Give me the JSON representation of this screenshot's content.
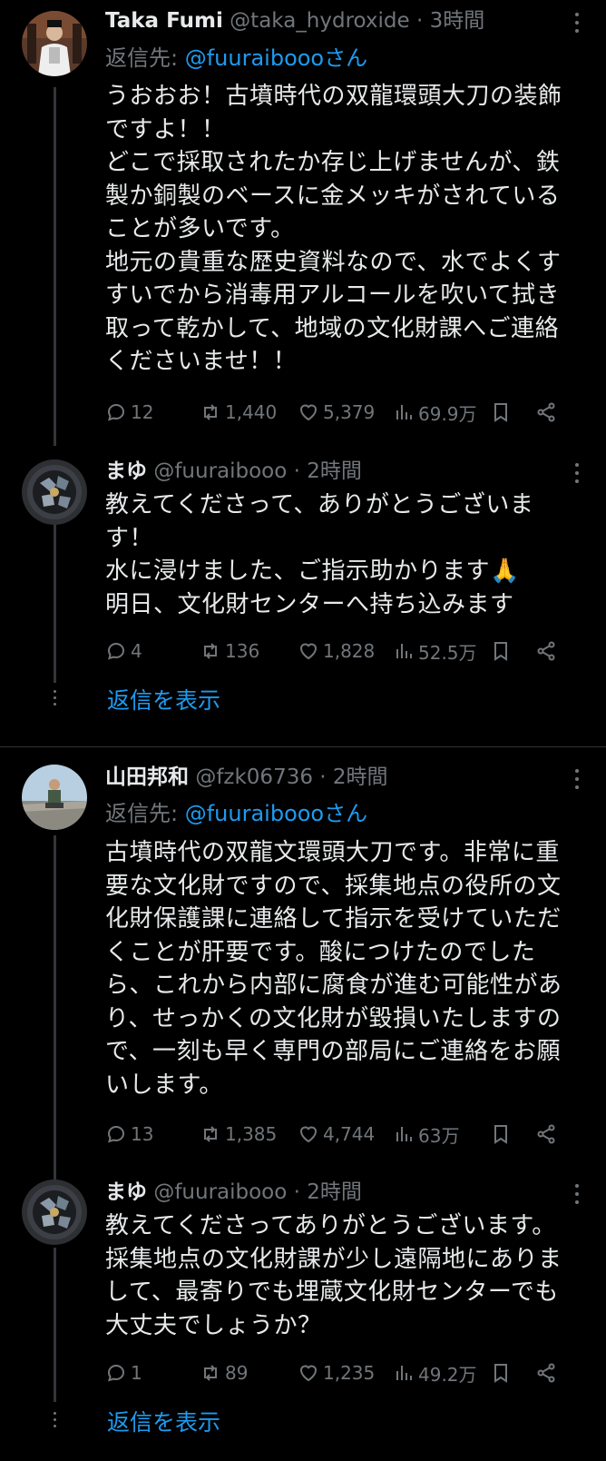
{
  "tweets": [
    {
      "name": "Taka Fumi",
      "handle": "@taka_hydroxide",
      "time": "3時間",
      "reply_prefix": "返信先: ",
      "reply_mention": "@fuuraibooo",
      "reply_suffix": "さん",
      "lines": [
        "うおおお！古墳時代の双龍環頭大刀の装飾",
        "ですよ！！",
        "どこで採取されたか存じ上げませんが、鉄",
        "製か銅製のベースに金メッキがされている",
        "ことが多いです。",
        "地元の貴重な歴史資料なので、水でよくす",
        "すいでから消毒用アルコールを吹いて拭き",
        "取って乾かして、地域の文化財課へご連絡",
        "くださいませ！！"
      ],
      "replies": "12",
      "retweets": "1,440",
      "likes": "5,379",
      "views": "69.9万"
    },
    {
      "name": "まゆ",
      "handle": "@fuuraibooo",
      "time": "2時間",
      "lines": [
        "教えてくださって、ありがとうございま",
        "す！",
        "水に浸けました、ご指示助かります🙏",
        "明日、文化財センターへ持ち込みます"
      ],
      "replies": "4",
      "retweets": "136",
      "likes": "1,828",
      "views": "52.5万"
    },
    {
      "name": "山田邦和",
      "handle": "@fzk06736",
      "time": "2時間",
      "reply_prefix": "返信先: ",
      "reply_mention": "@fuuraibooo",
      "reply_suffix": "さん",
      "lines": [
        "古墳時代の双龍文環頭大刀です。非常に重",
        "要な文化財ですので、採集地点の役所の文",
        "化財保護課に連絡して指示を受けていただ",
        "くことが肝要です。酸につけたのでした",
        "ら、これから内部に腐食が進む可能性があ",
        "り、せっかくの文化財が毀損いたしますの",
        "で、一刻も早く専門の部局にご連絡をお願",
        "いします。"
      ],
      "replies": "13",
      "retweets": "1,385",
      "likes": "4,744",
      "views": "63万"
    },
    {
      "name": "まゆ",
      "handle": "@fuuraibooo",
      "time": "2時間",
      "lines": [
        "教えてくださってありがとうございます。",
        "採集地点の文化財課が少し遠隔地にありま",
        "して、最寄りでも埋蔵文化財センターでも",
        "大丈夫でしょうか？"
      ],
      "replies": "1",
      "retweets": "89",
      "likes": "1,235",
      "views": "49.2万"
    }
  ],
  "show_replies_label": "返信を表示",
  "separator": "·",
  "colors": {
    "background": "#000000",
    "text": "#e7e9ea",
    "muted": "#71767b",
    "link": "#1d9bf0"
  }
}
